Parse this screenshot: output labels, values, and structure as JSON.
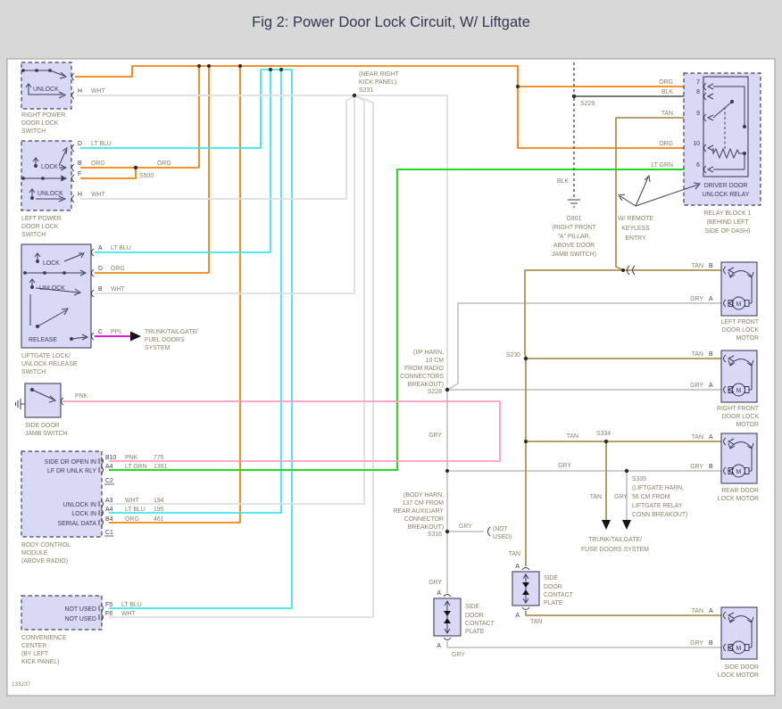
{
  "title": "Fig 2: Power Door Lock Circuit, W/ Liftgate",
  "doc_number": "133237",
  "colors": {
    "org": "#F5820D",
    "lt_blu": "#3BE6F0",
    "wht": "#DEDEDE",
    "gry": "#C6C6C6",
    "tan": "#AC9353",
    "lt_grn": "#1FDC1F",
    "pnk": "#FF9DC0",
    "ppl": "#F013D8",
    "blk": "#4F4F4F",
    "component_fill": "#D9D9F6",
    "label_text": "#8A8164",
    "dark_text": "#3C3C5A",
    "title_text": "#2F3950"
  },
  "right_switch": {
    "internal": "UNLOCK",
    "pin_h": "H",
    "wht": "WHT",
    "name": [
      "RIGHT POWER",
      "DOOR LOCK",
      "SWITCH"
    ]
  },
  "left_switch": {
    "pin_d": "D",
    "lt_blu": "LT BLU",
    "lock": "LOCK",
    "pin_b": "B",
    "org1": "ORG",
    "org2": "ORG",
    "s500": "S500",
    "pin_f": "F",
    "org3": "ORG",
    "unlock": "UNLOCK",
    "pin_h": "H",
    "wht": "WHT",
    "name": [
      "LEFT POWER",
      "DOOR LOCK",
      "SWITCH"
    ]
  },
  "liftgate_switch": {
    "pin_a": "A",
    "lt_blu": "LT BLU",
    "lock": "LOCK",
    "pin_d": "D",
    "org": "ORG",
    "unlock": "UNLOCK",
    "pin_b": "B",
    "wht": "WHT",
    "release": "RELEASE",
    "pin_c": "C",
    "ppl": "PPL",
    "dest": [
      "TRUNK/TAILGATE/",
      "FUEL DOORS",
      "SYSTEM"
    ],
    "name": [
      "LIFTGATE LOCK/",
      "UNLOCK RELEASE",
      "SWITCH"
    ]
  },
  "jamb_switch": {
    "pnk": "PNK",
    "name": [
      "SIDE DOOR",
      "JAMB SWITCH"
    ]
  },
  "bcm": {
    "rows": [
      {
        "sig": "SIDE DR OPEN IN",
        "pin": "B10",
        "color": "PNK",
        "ckt": "775"
      },
      {
        "sig": "LF DR UNLK RLY",
        "pin": "A4",
        "color": "LT GRN",
        "ckt": "1391"
      },
      {
        "sig": "UNLOCK IN",
        "pin": "A3",
        "color": "WHT",
        "ckt": "194"
      },
      {
        "sig": "LOCK IN",
        "pin": "A4",
        "color": "LT BLU",
        "ckt": "195"
      },
      {
        "sig": "SERIAL DATA",
        "pin": "B4",
        "color": "ORG",
        "ckt": "461"
      }
    ],
    "c2": "C2",
    "c1": "C1",
    "name": [
      "BODY CONTROL",
      "MODULE",
      "(ABOVE RADIO)"
    ]
  },
  "convenience": {
    "row1": {
      "sig": "NOT USED",
      "pin": "F5",
      "color": "LT BLU"
    },
    "row2": {
      "sig": "NOT USED",
      "pin": "F6",
      "color": "WHT"
    },
    "name": [
      "CONVENIENCE",
      "CENTER",
      "(BY LEFT",
      "KICK PANEL)"
    ]
  },
  "s231": {
    "note": [
      "(NEAR RIGHT",
      "KICK PANEL)"
    ],
    "id": "S231"
  },
  "s228": {
    "note": [
      "(I/P HARN,",
      "10 CM",
      "FROM RADIO",
      "CONNECTORS",
      "BREAKOUT)"
    ],
    "id": "S228"
  },
  "s316": {
    "note": [
      "(BODY HARN,",
      "137 CM FROM",
      "REAR AUXILIARY",
      "CONNECTOR",
      "BREAKOUT)"
    ],
    "id": "S316",
    "stub_color": "GRY",
    "not_used": [
      "(NOT",
      "USED)"
    ]
  },
  "s230": "S230",
  "s334": "S334",
  "s335": {
    "id": "S335",
    "note": [
      "(LIFTGATE HARN,",
      "56 CM FROM",
      "LIFTGATE RELAY",
      "CONN BREAKOUT)"
    ]
  },
  "trunk_fuse": {
    "tan": "TAN",
    "gry": "GRY",
    "dest": [
      "TRUNK/TAILGATE/",
      "FUSE DOORS SYSTEM"
    ]
  },
  "relay": {
    "pins": [
      {
        "color": "ORG",
        "num": "7"
      },
      {
        "color": "BLK",
        "num": "8"
      },
      {
        "color": "TAN",
        "num": "9"
      },
      {
        "color": "ORG",
        "num": "10"
      },
      {
        "color": "LT GRN",
        "num": "6"
      }
    ],
    "inner": [
      "DRIVER DOOR",
      "UNLOCK RELAY"
    ],
    "name": [
      "RELAY BLOCK 1",
      "(BEHIND LEFT",
      "SIDE OF DASH)"
    ]
  },
  "s229": "S229",
  "blk_label": "BLK",
  "g901": [
    "G901",
    "(RIGHT FRONT",
    "\"A\" PILLAR,",
    "ABOVE DOOR",
    "JAMB SWITCH)"
  ],
  "keyless": [
    "W/ REMOTE",
    "KEYLESS",
    "ENTRY"
  ],
  "motors": {
    "left_front": {
      "p1c": "TAN",
      "p1": "B",
      "p2c": "GRY",
      "p2": "A",
      "m": "M",
      "name": [
        "LEFT FRONT",
        "DOOR LOCK",
        "MOTOR"
      ]
    },
    "right_front": {
      "p1c": "TAN",
      "p1": "B",
      "p2c": "GRY",
      "p2": "A",
      "m": "M",
      "name": [
        "RIGHT FRONT",
        "DOOR LOCK",
        "MOTOR"
      ]
    },
    "rear": {
      "p1c": "TAN",
      "p1": "A",
      "p2c": "GRY",
      "p2": "B",
      "m": "M",
      "name": [
        "REAR DOOR",
        "LOCK MOTOR"
      ]
    },
    "side": {
      "p1c": "TAN",
      "p1": "A",
      "p2c": "GRY",
      "p2": "B",
      "m": "M",
      "name": [
        "SIDE DOOR",
        "LOCK MOTOR"
      ]
    }
  },
  "plates": {
    "left": {
      "pin_top": "A",
      "pin_bottom": "A",
      "out_color": "GRY",
      "name": [
        "SIDE",
        "DOOR",
        "CONTACT",
        "PLATE"
      ]
    },
    "right": {
      "pin_top": "A",
      "pin_bottom": "A",
      "out_color": "TAN",
      "name": [
        "SIDE",
        "DOOR",
        "CONTACT",
        "PLATE"
      ]
    }
  },
  "inline_labels": {
    "v_gry_upper": "GRY",
    "v_gry_lower": "GRY",
    "v_tan_plate": "TAN",
    "tan_before_s334": "TAN",
    "gry_before_s335": "GRY"
  }
}
